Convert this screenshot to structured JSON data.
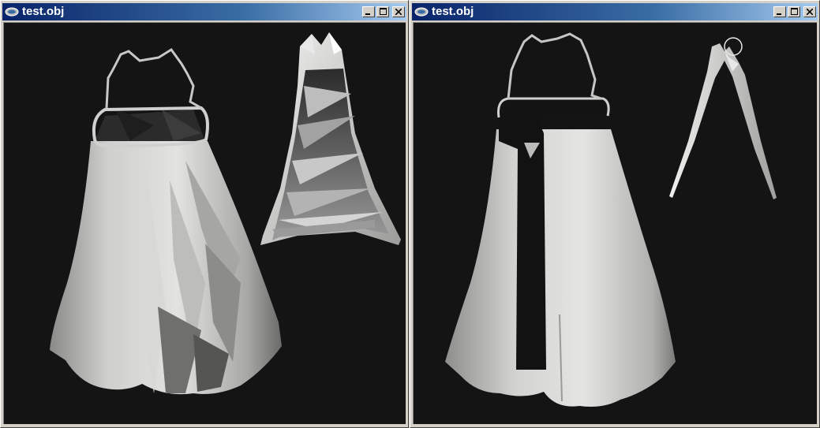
{
  "windows": [
    {
      "title": "test.obj",
      "icon": "app-icon",
      "controls": [
        "minimize-icon",
        "maximize-icon",
        "close-icon"
      ],
      "viewport_background": "#141414"
    },
    {
      "title": "test.obj",
      "icon": "app-icon",
      "controls": [
        "minimize-icon",
        "maximize-icon",
        "close-icon"
      ],
      "viewport_background": "#141414"
    }
  ],
  "colors": {
    "titlebar_start": "#0a246a",
    "titlebar_end": "#a6caf0",
    "window_face": "#d4d0c8",
    "mesh_light": "#e6e6e4",
    "mesh_shadow": "#6e6e6e"
  }
}
